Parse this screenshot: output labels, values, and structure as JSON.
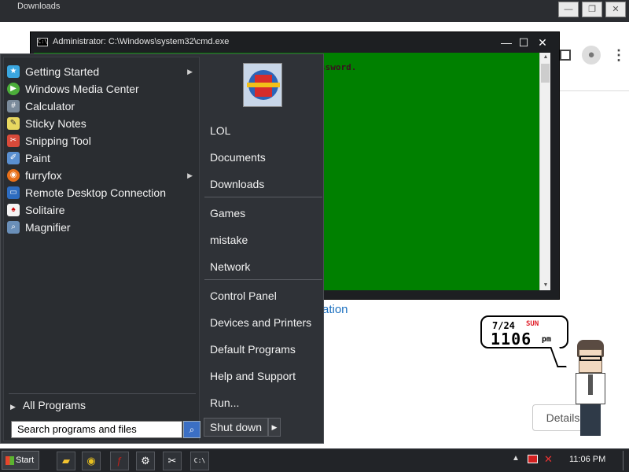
{
  "background_browser": {
    "window_title": "Downloads",
    "link_text": "ation",
    "details_button": "Details"
  },
  "cmd": {
    "title": "Administrator: C:\\Windows\\system32\\cmd.exe",
    "text": "ssword.",
    "icon_label": "C:\\"
  },
  "start_menu": {
    "programs": [
      {
        "label": "Getting Started",
        "icon": "getting-started-icon",
        "has_submenu": true
      },
      {
        "label": "Windows Media Center",
        "icon": "media-center-icon",
        "has_submenu": false
      },
      {
        "label": "Calculator",
        "icon": "calculator-icon",
        "has_submenu": false
      },
      {
        "label": "Sticky Notes",
        "icon": "sticky-notes-icon",
        "has_submenu": false
      },
      {
        "label": "Snipping Tool",
        "icon": "snipping-tool-icon",
        "has_submenu": false
      },
      {
        "label": "Paint",
        "icon": "paint-icon",
        "has_submenu": false
      },
      {
        "label": "furryfox",
        "icon": "firefox-icon",
        "has_submenu": true
      },
      {
        "label": "Remote Desktop Connection",
        "icon": "remote-desktop-icon",
        "has_submenu": false
      },
      {
        "label": "Solitaire",
        "icon": "solitaire-icon",
        "has_submenu": false
      },
      {
        "label": "Magnifier",
        "icon": "magnifier-icon",
        "has_submenu": false
      }
    ],
    "all_programs": "All Programs",
    "search_value": "Search programs and files",
    "places": [
      {
        "label": "LOL"
      },
      {
        "label": "Documents"
      },
      {
        "label": "Downloads"
      },
      {
        "label": "Games"
      },
      {
        "label": "mistake"
      },
      {
        "label": "Network"
      },
      {
        "label": "Control Panel"
      },
      {
        "label": "Devices and Printers"
      },
      {
        "label": "Default Programs"
      },
      {
        "label": "Help and Support"
      },
      {
        "label": "Run..."
      }
    ],
    "shutdown_label": "Shut down"
  },
  "clock_widget": {
    "date": "7/24",
    "day": "SUN",
    "time": "1106",
    "ampm": "pm"
  },
  "taskbar": {
    "start_label": "Start",
    "tray_time": "11:06 PM"
  },
  "colors": {
    "cmd_background": "#008000",
    "start_menu_background": "#2f3237",
    "taskbar_background": "#222428"
  }
}
